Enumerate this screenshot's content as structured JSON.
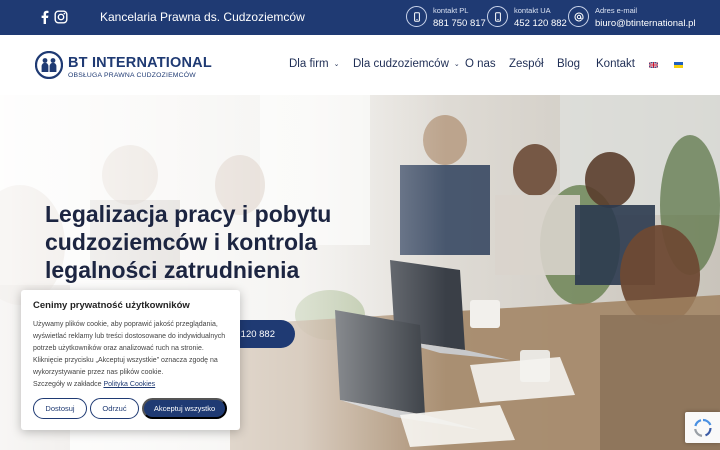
{
  "topbar": {
    "tagline": "Kancelaria Prawna ds. Cudzoziemców",
    "social": [
      {
        "icon": "facebook-icon"
      },
      {
        "icon": "instagram-icon"
      }
    ],
    "contacts": [
      {
        "icon": "phone-icon",
        "label": "kontakt PL",
        "value": "881 750 817"
      },
      {
        "icon": "phone-icon",
        "label": "kontakt UA",
        "value": "452 120 882"
      },
      {
        "icon": "at-sign-icon",
        "label": "Adres e-mail",
        "value": "biuro@btinternational.pl"
      }
    ]
  },
  "header": {
    "logo": {
      "name": "BT INTERNATIONAL",
      "subtitle": "OBSŁUGA PRAWNA CUDZOZIEMCÓW"
    },
    "nav": [
      {
        "label": "Dla firm",
        "has_dropdown": true
      },
      {
        "label": "Dla cudzoziemców",
        "has_dropdown": true
      },
      {
        "label": "O nas",
        "has_dropdown": false
      },
      {
        "label": "Zespół",
        "has_dropdown": false
      },
      {
        "label": "Blog",
        "has_dropdown": false
      },
      {
        "label": "Kontakt",
        "has_dropdown": false
      }
    ],
    "languages": [
      {
        "icon": "uk-flag-icon"
      },
      {
        "icon": "ukraine-flag-icon"
      }
    ]
  },
  "hero": {
    "title": "Legalizacja pracy i pobytu cudzoziemców i kontrola legalności zatrudnienia",
    "cta_visible_text": "2 120 882"
  },
  "cookie": {
    "title": "Cenimy prywatność użytkowników",
    "text": "Używamy plików cookie, aby poprawić jakość przeglądania, wyświetlać reklamy lub treści dostosowane do indywidualnych potrzeb użytkowników oraz analizować ruch na stronie. Kliknięcie przycisku „Akceptuj wszystkie” oznacza zgodę na wykorzystywanie przez nas plików cookie.",
    "details_prefix": "Szczegóły w zakładce",
    "details_link": "Polityka Cookies",
    "buttons": {
      "customize": "Dostosuj",
      "reject": "Odrzuć",
      "accept": "Akceptuj wszystko"
    }
  },
  "colors": {
    "brand_navy": "#1f3a73",
    "text_dark": "#1c2541",
    "white": "#ffffff"
  }
}
